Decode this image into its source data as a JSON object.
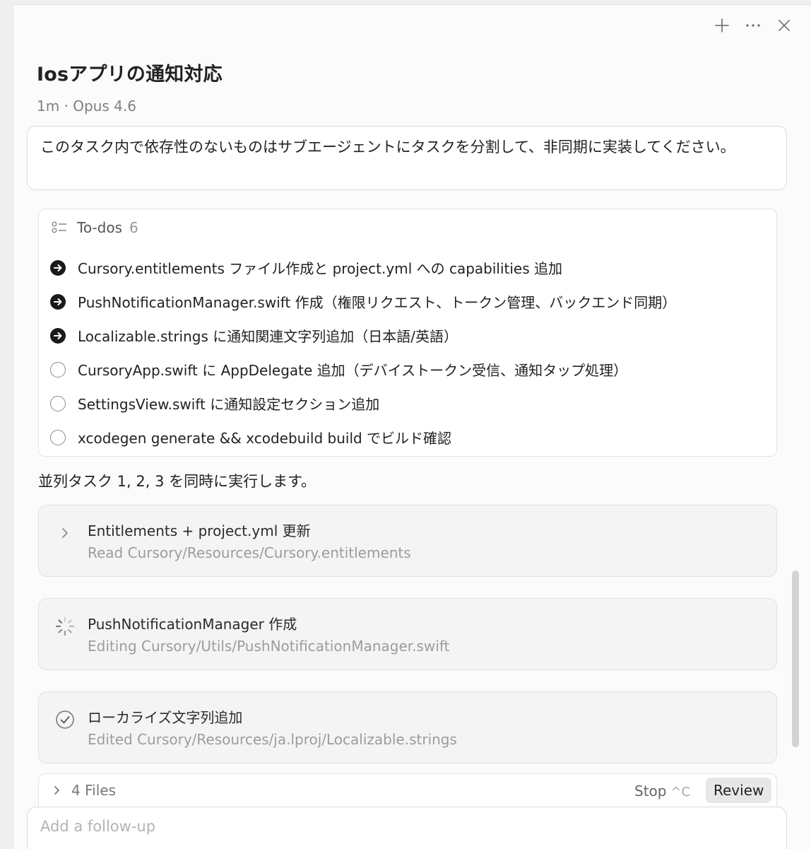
{
  "header": {
    "title": "Iosアプリの通知対応",
    "meta": "1m · Opus 4.6",
    "actions": [
      {
        "name": "new-icon"
      },
      {
        "name": "more-icon"
      },
      {
        "name": "close-icon"
      }
    ]
  },
  "prompt": {
    "text": "このタスク内で依存性のないものはサブエージェントにタスクを分割して、非同期に実装してください。"
  },
  "todos": {
    "label": "To-dos",
    "count": "6",
    "items": [
      {
        "text": "Cursory.entitlements ファイル作成と project.yml への capabilities 追加",
        "status": "in-progress"
      },
      {
        "text": "PushNotificationManager.swift 作成（権限リクエスト、トークン管理、バックエンド同期）",
        "status": "in-progress"
      },
      {
        "text": "Localizable.strings に通知関連文字列追加（日本語/英語）",
        "status": "in-progress"
      },
      {
        "text": "CursoryApp.swift に AppDelegate 追加（デバイストークン受信、通知タップ処理）",
        "status": "pending"
      },
      {
        "text": "SettingsView.swift に通知設定セクション追加",
        "status": "pending"
      },
      {
        "text": "xcodegen generate && xcodebuild build でビルド確認",
        "status": "pending"
      }
    ]
  },
  "status_line": "並列タスク 1, 2, 3 を同時に実行します。",
  "tasks": [
    {
      "name": "Entitlements + project.yml 更新",
      "detail": "Read Cursory/Resources/Cursory.entitlements",
      "icon": "chevron-right-icon"
    },
    {
      "name": "PushNotificationManager 作成",
      "detail": "Editing Cursory/Utils/PushNotificationManager.swift",
      "icon": "spinner-icon"
    },
    {
      "name": "ローカライズ文字列追加",
      "detail": "Edited Cursory/Resources/ja.lproj/Localizable.strings",
      "icon": "check-circle-icon"
    }
  ],
  "files_bar": {
    "files_label": "4 Files",
    "stop_label": "Stop",
    "stop_shortcut": "^C",
    "review_label": "Review"
  },
  "followup": {
    "placeholder": "Add a follow-up",
    "value": ""
  },
  "colors": {
    "background": "#fbfbfb",
    "card": "#f4f4f4",
    "text": "#222222",
    "muted": "#9c9c9c"
  }
}
